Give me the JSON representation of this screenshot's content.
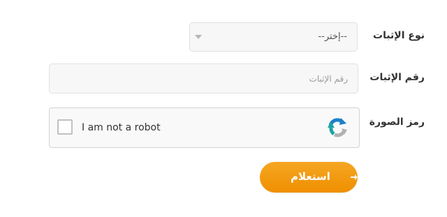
{
  "form": {
    "proof_type_label": "نوع الإثبات",
    "proof_type_selected": "--إختر--",
    "proof_number_label": "رقم الإثبات",
    "proof_number_placeholder": "رقم الإثبات",
    "proof_number_value": "",
    "image_code_label": "رمز الصورة",
    "captcha_label": "I am not a robot",
    "submit_label": "استعلام"
  },
  "icons": {
    "select_arrow": "chevron-down-icon",
    "captcha_logo": "recaptcha-icon",
    "submit_arrow": "arrow-right-icon"
  },
  "colors": {
    "accent": "#f29a0c",
    "field_background": "#f7f7f7",
    "field_border": "#e0e0e0",
    "label_text": "#333333"
  }
}
